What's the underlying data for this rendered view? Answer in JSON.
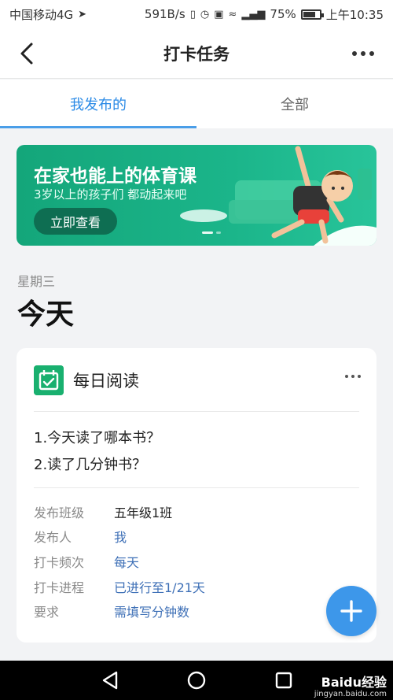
{
  "status_bar": {
    "carrier": "中国移动4G",
    "speed": "591B/s",
    "battery_percent": "75%",
    "battery_level": 0.75,
    "time": "上午10:35"
  },
  "navbar": {
    "title": "打卡任务"
  },
  "tabs": [
    {
      "label": "我发布的",
      "active": true
    },
    {
      "label": "全部",
      "active": false
    }
  ],
  "banner": {
    "title": "在家也能上的体育课",
    "subtitle": "3岁以上的孩子们 都动起来吧",
    "button_label": "立即查看"
  },
  "day": {
    "weekday": "星期三",
    "heading": "今天"
  },
  "task_card": {
    "title": "每日阅读",
    "questions": [
      "1.今天读了哪本书？",
      "2.读了几分钟书？"
    ],
    "details": [
      {
        "label": "发布班级",
        "value": "五年级1班"
      },
      {
        "label": "发布人",
        "value": "我"
      },
      {
        "label": "打卡频次",
        "value": "每天"
      },
      {
        "label": "打卡进程",
        "value": "已进行至1/21天"
      },
      {
        "label": "要求",
        "value": "需填写分钟数"
      }
    ]
  },
  "watermark": {
    "brand": "Baidu经验",
    "url": "jingyan.baidu.com"
  },
  "colors": {
    "accent": "#2a8ae6",
    "banner": "#1bb58a",
    "fab": "#3d97ea",
    "task_icon": "#19b06f"
  }
}
